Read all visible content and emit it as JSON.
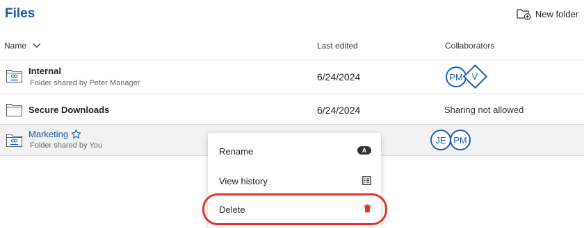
{
  "header": {
    "title": "Files",
    "new_folder_label": "New folder"
  },
  "columns": {
    "name": "Name",
    "last_edited": "Last edited",
    "collaborators": "Collaborators"
  },
  "rows": [
    {
      "title": "Internal",
      "subtitle": "Folder shared by Peter Manager",
      "date": "6/24/2024",
      "collaborators": [
        "PM",
        "V"
      ]
    },
    {
      "title": "Secure Downloads",
      "date": "6/24/2024",
      "sharing": "Sharing not allowed"
    },
    {
      "title": "Marketing",
      "subtitle": "Folder shared by You",
      "collaborators": [
        "JE",
        "PM"
      ]
    }
  ],
  "context_menu": {
    "rename": "Rename",
    "rename_shortcut": "A",
    "view_history": "View history",
    "delete": "Delete"
  },
  "colors": {
    "accent": "#1558b0",
    "delete": "#e4322b",
    "highlight": "#e4322b"
  }
}
